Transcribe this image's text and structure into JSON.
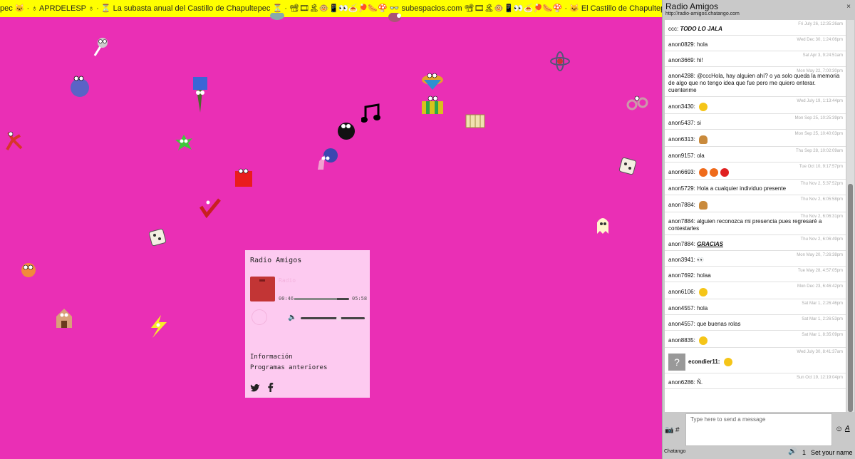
{
  "marquee": {
    "text": "pec 🐱 · ♁ APRDELESP ♁ · ⏳ La subasta anual del Castillo de Chapultepec ⏳ · 📽🎞🏝🐵📱👀🍝🏓🌭🍄 👓 subespacios.com 📽🎞🏝🐵📱👀🍝🏓🌭🍄 · 🐱 El Castillo de Chapultepec 🐱 · ♁ APRDELESP ♁ · ⏳ La subasta anual del Castillo de Chapultepec ⏳ · 📽🎞🏝🐵📱👀🍝🏓🌭🍄 👓 subespacios.com"
  },
  "player": {
    "title": "Radio Amigos",
    "track_hidden": "Radio",
    "time_elapsed": "00:46",
    "time_total": "05:58",
    "progress": 0.78,
    "volume": 0.55,
    "link_info": "Información",
    "link_archive": "Programas anteriores",
    "social_twitter": "twitter-icon",
    "social_facebook": "facebook-icon"
  },
  "chat": {
    "title": "Radio Amigos",
    "url": "http://radio-amigos.chatango.com",
    "close": "×",
    "placeholder": "Type here to send a message",
    "brand": "Chatango",
    "user_count": "1",
    "set_name": "Set your name",
    "messages": [
      {
        "ts": "Fri July 26, 12:35:26am",
        "user": "ccc:",
        "text": "TODO LO JALA",
        "style": "bi"
      },
      {
        "ts": "Wed Dec 30, 1:24:06pm",
        "user": "anon0829:",
        "text": "hola"
      },
      {
        "ts": "Sat Apr 3, 9:24:51am",
        "user": "anon3669:",
        "text": "hi!"
      },
      {
        "ts": "Mon May 22, 7:00:30pm",
        "user": "anon4288:",
        "text": "@cccHola, hay alguien ahí? o ya solo queda la memoria de algo que no tengo idea que fue pero me quiero enterar. cuentenme",
        "mention": "@cccHola"
      },
      {
        "ts": "Wed July 19, 1:13:44pm",
        "user": "anon3430:",
        "text": "",
        "emo": [
          "smile"
        ]
      },
      {
        "ts": "Mon Sep 25, 10:25:39pm",
        "user": "anon5437:",
        "text": "si"
      },
      {
        "ts": "Mon Sep 25, 10:40:03pm",
        "user": "anon6313:",
        "text": "",
        "emo": [
          "burger"
        ]
      },
      {
        "ts": "Thu Sep 28, 10:02:09am",
        "user": "anon9157:",
        "text": "ola"
      },
      {
        "ts": "Tue Oct 10, 9:17:57pm",
        "user": "anon6693:",
        "text": "",
        "emo": [
          "red",
          "red",
          "stop"
        ]
      },
      {
        "ts": "Thu Nov 2, 5:37:52pm",
        "user": "anon5729:",
        "text": "Hola a cualquier individuo presente"
      },
      {
        "ts": "Thu Nov 2, 6:05:58pm",
        "user": "anon7884:",
        "text": "",
        "emo": [
          "burger"
        ]
      },
      {
        "ts": "Thu Nov 2, 6:06:31pm",
        "user": "anon7884:",
        "text": "alguien reconozca mi presencia pues regresaré a contestarles"
      },
      {
        "ts": "Thu Nov 2, 6:06:49pm",
        "user": "anon7884:",
        "text": "GRACIAS",
        "style": "biu"
      },
      {
        "ts": "Mon May 20, 7:26:38pm",
        "user": "anon3941:",
        "text": "👀"
      },
      {
        "ts": "Tue May 28, 4:57:05pm",
        "user": "anon7692:",
        "text": "holaa"
      },
      {
        "ts": "Mon Dec 23, 6:46:42pm",
        "user": "anon6106:",
        "text": "",
        "emo": [
          "smile"
        ]
      },
      {
        "ts": "Sat Mar 1, 2:26:46pm",
        "user": "anon4557:",
        "text": "hola"
      },
      {
        "ts": "Sat Mar 1, 2:26:53pm",
        "user": "anon4557:",
        "text": "que buenas rolas"
      },
      {
        "ts": "Sat Mar 1, 8:35:09pm",
        "user": "anon8835:",
        "text": "",
        "emo": [
          "smile"
        ]
      },
      {
        "ts": "Wed July 30, 8:41:37am",
        "user": "econdier11:",
        "text": "",
        "emo": [
          "cool"
        ],
        "avatar": true
      },
      {
        "ts": "Sun Oct 19, 12:19:04pm",
        "user": "anon6286:",
        "text": "Ñ."
      }
    ]
  }
}
